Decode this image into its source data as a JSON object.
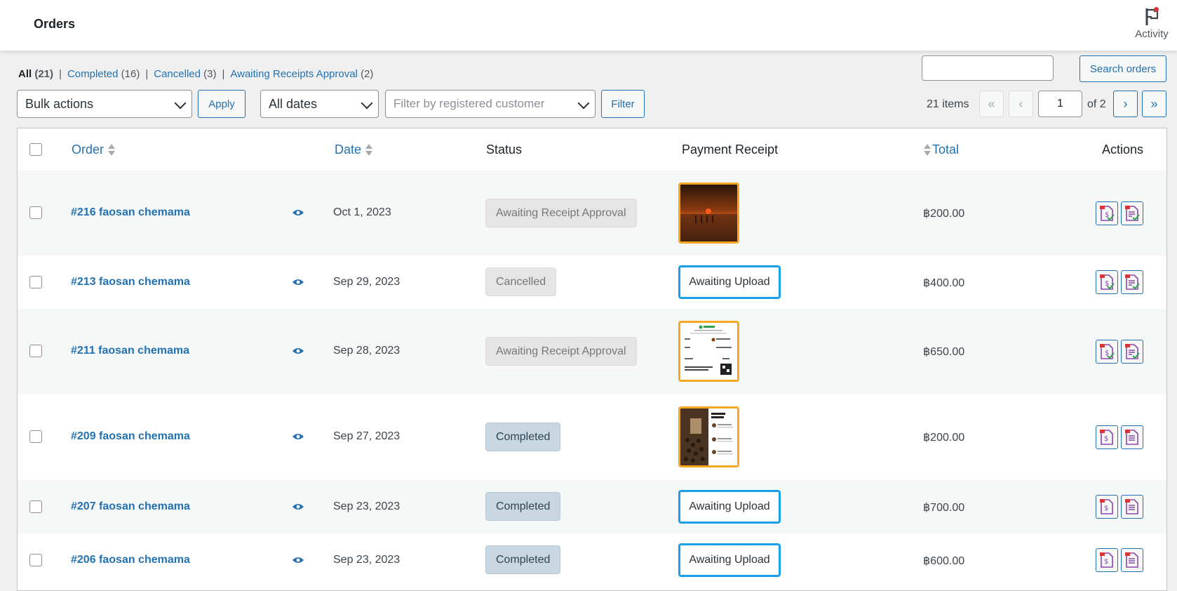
{
  "header": {
    "title": "Orders",
    "activity_label": "Activity"
  },
  "filters": {
    "views": [
      {
        "label": "All",
        "count": "(21)"
      },
      {
        "label": "Completed",
        "count": "(16)"
      },
      {
        "label": "Cancelled",
        "count": "(3)"
      },
      {
        "label": "Awaiting Receipts Approval",
        "count": "(2)"
      }
    ],
    "separator": "|",
    "search_button": "Search orders",
    "bulk_actions": "Bulk actions",
    "apply": "Apply",
    "dates": "All dates",
    "customer_placeholder": "Filter by registered customer",
    "filter": "Filter"
  },
  "pagination": {
    "items": "21 items",
    "first": "«",
    "prev": "‹",
    "current": "1",
    "of": "of 2",
    "next": "›",
    "last": "»"
  },
  "table": {
    "columns": {
      "order": "Order",
      "date": "Date",
      "status": "Status",
      "receipt": "Payment Receipt",
      "total": "Total",
      "actions": "Actions"
    },
    "rows": [
      {
        "order": "#216 faosan chemama",
        "date": "Oct 1, 2023",
        "status": "Awaiting Receipt Approval",
        "status_type": "awaiting",
        "receipt": "image-sunset",
        "receipt_text": "",
        "total": "฿200.00"
      },
      {
        "order": "#213 faosan chemama",
        "date": "Sep 29, 2023",
        "status": "Cancelled",
        "status_type": "cancelled",
        "receipt": "upload",
        "receipt_text": "Awaiting Upload",
        "total": "฿400.00"
      },
      {
        "order": "#211 faosan chemama",
        "date": "Sep 28, 2023",
        "status": "Awaiting Receipt Approval",
        "status_type": "awaiting",
        "receipt": "image-slip",
        "receipt_text": "",
        "total": "฿650.00"
      },
      {
        "order": "#209 faosan chemama",
        "date": "Sep 27, 2023",
        "status": "Completed",
        "status_type": "completed",
        "receipt": "image-coffee",
        "receipt_text": "",
        "total": "฿200.00"
      },
      {
        "order": "#207 faosan chemama",
        "date": "Sep 23, 2023",
        "status": "Completed",
        "status_type": "completed",
        "receipt": "upload",
        "receipt_text": "Awaiting Upload",
        "total": "฿700.00"
      },
      {
        "order": "#206 faosan chemama",
        "date": "Sep 23, 2023",
        "status": "Completed",
        "status_type": "completed",
        "receipt": "upload",
        "receipt_text": "Awaiting Upload",
        "total": "฿600.00"
      }
    ]
  },
  "colors": {
    "link": "#2271b1",
    "receipt_border": "#f5a623",
    "upload_border": "#1aa0e8"
  },
  "icons": [
    "flag-icon",
    "eye-icon",
    "invoice-icon",
    "packing-slip-icon",
    "check-icon",
    "sort-icon",
    "chevron-down-icon"
  ]
}
